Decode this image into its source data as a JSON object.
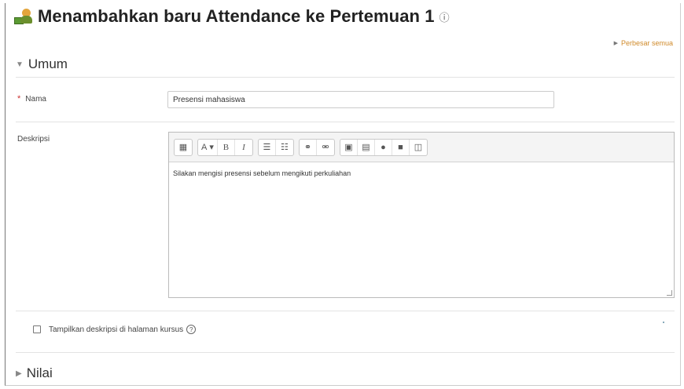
{
  "header": {
    "title": "Menambahkan baru Attendance ke Pertemuan 1",
    "help_glyph": "Ⓔ",
    "title_icon": "attendance-icon"
  },
  "expand_all": "Perbesar semua",
  "sections": {
    "umum": "Umum",
    "nilai": "Nilai"
  },
  "form": {
    "nama_label": "Nama",
    "required_mark": "*",
    "nama_value": "Presensi mahasiswa",
    "deskripsi_label": "Deskripsi",
    "deskripsi_content": "Silakan mengisi presensi sebelum mengikuti perkuliahan",
    "checkbox_label": "Tampilkan deskripsi di halaman kursus",
    "checkbox_checked": false
  },
  "toolbar": {
    "font_label": "A",
    "bold": "B",
    "italic": "I"
  },
  "colors": {
    "link": "#d08a2a",
    "required": "#cc3333"
  }
}
